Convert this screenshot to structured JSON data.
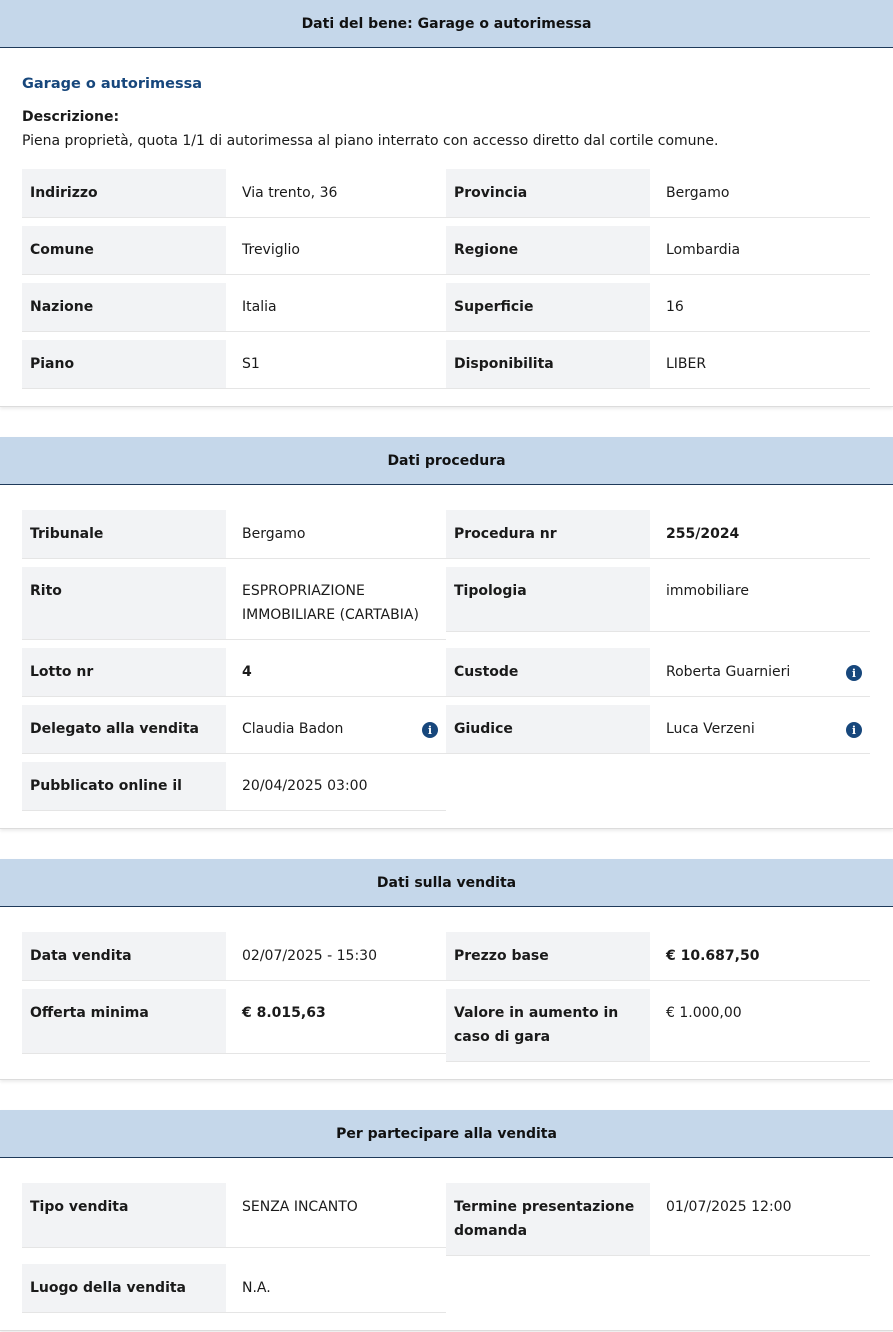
{
  "section_bene": {
    "title": "Dati del bene: Garage o autorimessa",
    "subtitle": "Garage o autorimessa",
    "description_label": "Descrizione:",
    "description": "Piena proprietà, quota 1/1 di autorimessa al piano interrato con accesso diretto dal cortile comune.",
    "fields": {
      "indirizzo": {
        "label": "Indirizzo",
        "value": "Via trento, 36"
      },
      "provincia": {
        "label": "Provincia",
        "value": "Bergamo"
      },
      "comune": {
        "label": "Comune",
        "value": "Treviglio"
      },
      "regione": {
        "label": "Regione",
        "value": "Lombardia"
      },
      "nazione": {
        "label": "Nazione",
        "value": "Italia"
      },
      "superficie": {
        "label": "Superficie",
        "value": "16"
      },
      "piano": {
        "label": "Piano",
        "value": "S1"
      },
      "disponibilita": {
        "label": "Disponibilita",
        "value": "LIBER"
      }
    }
  },
  "section_procedura": {
    "title": "Dati procedura",
    "fields": {
      "tribunale": {
        "label": "Tribunale",
        "value": "Bergamo"
      },
      "procedura_nr": {
        "label": "Procedura nr",
        "value": "255/2024"
      },
      "rito": {
        "label": "Rito",
        "value": "ESPROPRIAZIONE IMMOBILIARE (CARTABIA)"
      },
      "tipologia": {
        "label": "Tipologia",
        "value": "immobiliare"
      },
      "lotto_nr": {
        "label": "Lotto nr",
        "value": "4"
      },
      "custode": {
        "label": "Custode",
        "value": "Roberta Guarnieri"
      },
      "delegato": {
        "label": "Delegato alla vendita",
        "value": "Claudia Badon"
      },
      "giudice": {
        "label": "Giudice",
        "value": "Luca Verzeni"
      },
      "pubblicato": {
        "label": "Pubblicato online il",
        "value": "20/04/2025 03:00"
      }
    },
    "info_icon_glyph": "i"
  },
  "section_vendita": {
    "title": "Dati sulla vendita",
    "fields": {
      "data_vendita": {
        "label": "Data vendita",
        "value": "02/07/2025 - 15:30"
      },
      "prezzo_base": {
        "label": "Prezzo base",
        "value": "€ 10.687,50"
      },
      "offerta_minima": {
        "label": "Offerta minima",
        "value": "€ 8.015,63"
      },
      "valore_aumento": {
        "label": "Valore in aumento in caso di gara",
        "value": "€ 1.000,00"
      }
    }
  },
  "section_partecipare": {
    "title": "Per partecipare alla vendita",
    "fields": {
      "tipo_vendita": {
        "label": "Tipo vendita",
        "value": "SENZA INCANTO"
      },
      "termine": {
        "label": "Termine presentazione domanda",
        "value": "01/07/2025 12:00"
      },
      "luogo": {
        "label": "Luogo della vendita",
        "value": "N.A."
      }
    }
  },
  "colors": {
    "header_bg": "#c5d7ea",
    "header_border": "#1f3a5a",
    "label_bg": "#f2f3f5",
    "accent": "#17477c"
  }
}
